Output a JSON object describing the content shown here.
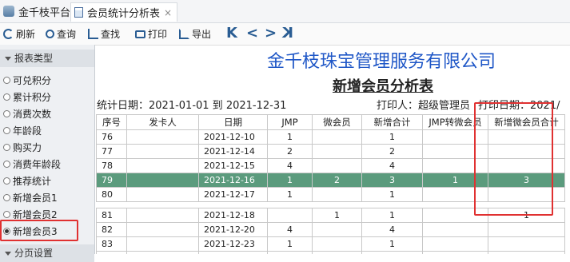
{
  "app": {
    "title": "金千枝平台"
  },
  "tab": {
    "label": "会员统计分析表",
    "close": "×"
  },
  "toolbar": {
    "refresh": "刷新",
    "query": "查询",
    "find": "查找",
    "print": "打印",
    "export": "导出",
    "nav": {
      "first": "K",
      "prev": "<",
      "next": ">",
      "last": "K"
    }
  },
  "sidebar": {
    "section_title": "报表类型",
    "options": [
      "可兑积分",
      "累计积分",
      "消费次数",
      "年龄段",
      "购买力",
      "消费年龄段",
      "推荐统计",
      "新增会员1",
      "新增会员2",
      "新增会员3"
    ],
    "selected": "新增会员3",
    "section2_title": "分页设置"
  },
  "report": {
    "company": "金千枝珠宝管理服务有限公司",
    "title": "新增会员分析表",
    "stat_date": "统计日期：2021-01-01 到 2021-12-31",
    "printer": "打印人：超级管理员",
    "print_date": "打印日期：2021/",
    "columns": [
      "序号",
      "发卡人",
      "日期",
      "JMP",
      "微会员",
      "新增合计",
      "JMP转微会员",
      "新增微会员合计"
    ],
    "rows": [
      [
        "76",
        "",
        "2021-12-10",
        "1",
        "",
        "1",
        "",
        ""
      ],
      [
        "77",
        "",
        "2021-12-14",
        "2",
        "",
        "2",
        "",
        ""
      ],
      [
        "78",
        "",
        "2021-12-15",
        "4",
        "",
        "4",
        "",
        ""
      ],
      [
        "79",
        "",
        "2021-12-16",
        "1",
        "2",
        "3",
        "1",
        "3"
      ],
      [
        "80",
        "",
        "2021-12-17",
        "1",
        "",
        "1",
        "",
        ""
      ],
      [
        "81",
        "",
        "2021-12-18",
        "",
        "1",
        "1",
        "",
        "1"
      ],
      [
        "82",
        "",
        "2021-12-20",
        "4",
        "",
        "4",
        "",
        ""
      ],
      [
        "83",
        "",
        "2021-12-23",
        "1",
        "",
        "1",
        "",
        ""
      ],
      [
        "84",
        "",
        "2021-12-24",
        "",
        "1",
        "1",
        "",
        "1"
      ]
    ]
  }
}
